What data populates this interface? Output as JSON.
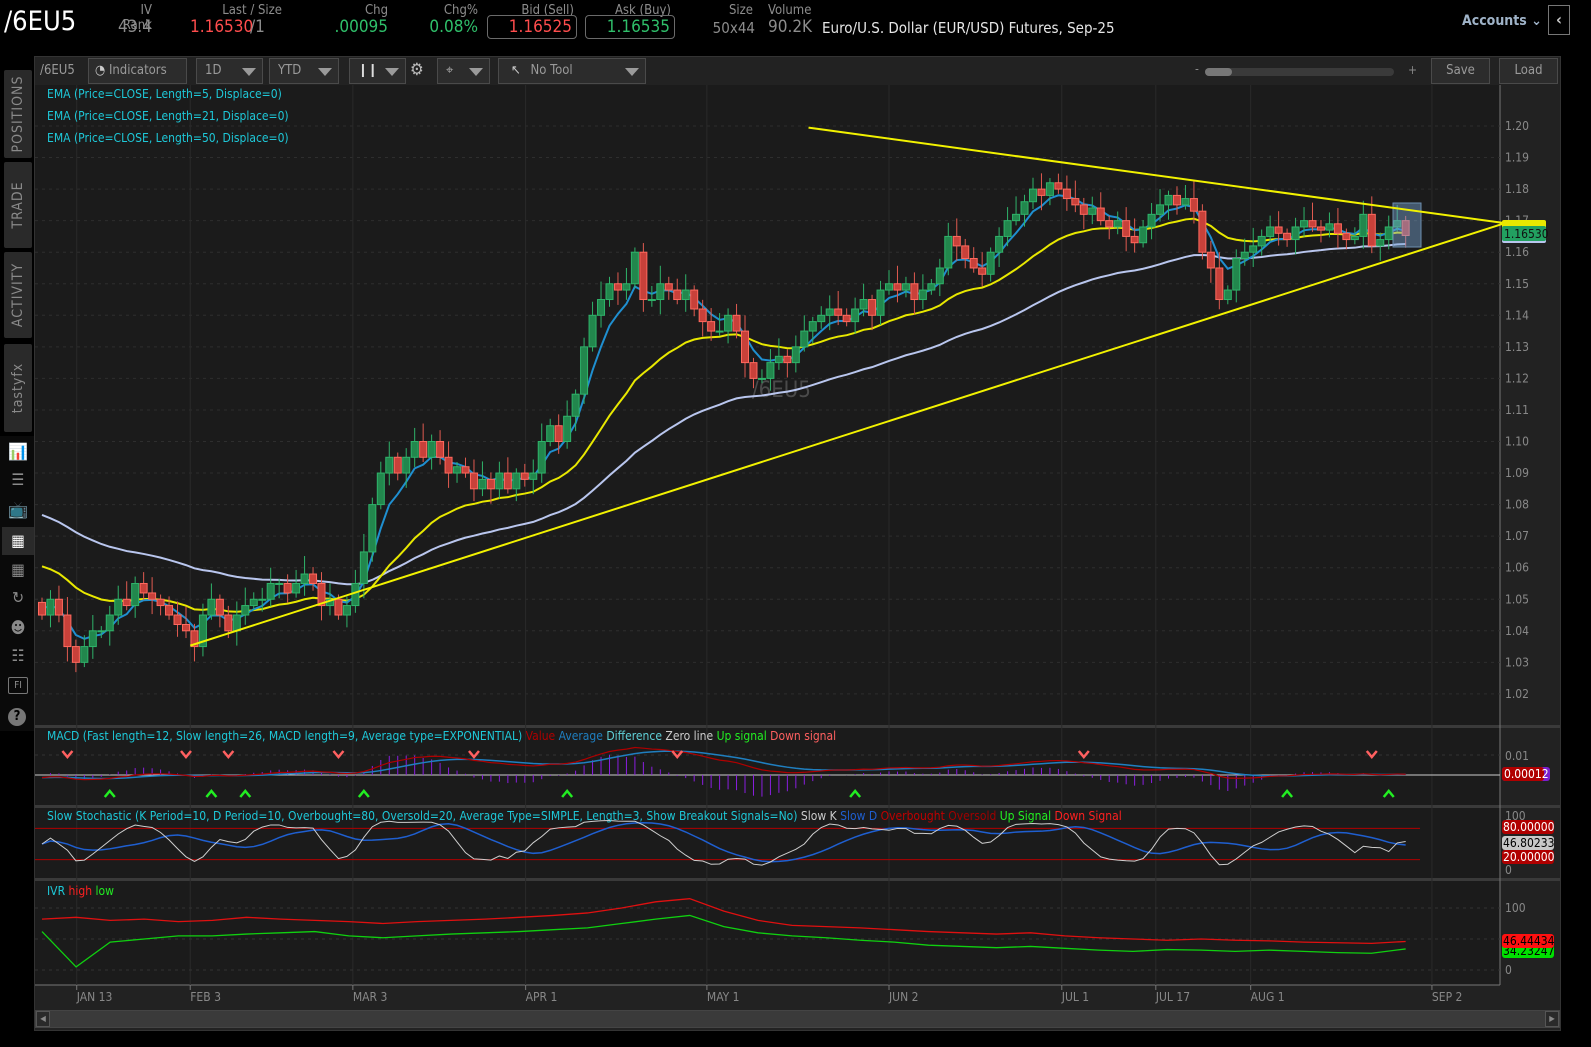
{
  "header": {
    "symbol": "/6EU5",
    "iv_rank_label": "IV Rank",
    "iv_rank": "43.4",
    "last_label": "Last / Size",
    "last": "1.16530",
    "size": "/1",
    "chg_label": "Chg",
    "chg": ".00095",
    "chgpct_label": "Chg%",
    "chgpct": "0.08%",
    "bid_label": "Bid (Sell)",
    "bid": "1.16525",
    "ask_label": "Ask (Buy)",
    "ask": "1.16535",
    "bidask_size_label": "Size",
    "bidask_size": "50x44",
    "volume_label": "Volume",
    "volume": "90.2K",
    "description": "Euro/U.S. Dollar (EUR/USD) Futures, Sep-25",
    "accounts": "Accounts"
  },
  "sidebar": {
    "tabs": [
      "POSITIONS",
      "TRADE",
      "ACTIVITY",
      "tastyfx"
    ],
    "icons": [
      "watchlist-chart-icon",
      "list-icon",
      "tv-icon",
      "chart-icon",
      "grid-icon",
      "history-icon",
      "community-icon",
      "calendar-icon",
      "fi-icon",
      "help-icon"
    ],
    "fi_label": "FI",
    "help_label": "?"
  },
  "toolbar": {
    "symbol": "/6EU5",
    "indicators": "Indicators",
    "interval": "1D",
    "range": "YTD",
    "tool": "No Tool",
    "zoom_minus": "-",
    "zoom_plus": "+",
    "zoom_level": 0.1,
    "save": "Save",
    "load": "Load"
  },
  "studies": {
    "ema5": "EMA (Price=CLOSE, Length=5, Displace=0)",
    "ema21": "EMA (Price=CLOSE, Length=21, Displace=0)",
    "ema50": "EMA (Price=CLOSE, Length=50, Displace=0)",
    "watermark": "/6EU5",
    "macd": {
      "title": "MACD (Fast length=12, Slow length=26, MACD length=9, Average type=EXPONENTIAL)",
      "value": "Value",
      "average": "Average",
      "difference": "Difference",
      "zero": "Zero line",
      "up": "Up signal",
      "down": "Down signal",
      "tick": "0.01",
      "last": "0.00012"
    },
    "stoch": {
      "title": "Slow Stochastic (K Period=10, D Period=10, Overbought=80, Oversold=20, Average Type=SIMPLE, Length=3, Show Breakout Signals=No)",
      "k": "Slow K",
      "d": "Slow D",
      "ob": "Overbought",
      "os": "Oversold",
      "up": "Up Signal",
      "down": "Down Signal",
      "t100": "100",
      "t0": "0",
      "ob_val": "80.00000",
      "k_val": "46.80233",
      "os_val": "20.00000"
    },
    "ivr": {
      "title": "IVR",
      "high": "high",
      "low": "low",
      "t100": "100",
      "t0": "0",
      "high_val": "46.44434",
      "low_val": "34.23247"
    }
  },
  "colors": {
    "up": "#22874d",
    "down": "#c8413a",
    "ema5": "#1f8fd0",
    "ema21": "#e8e800",
    "ema50": "#b9c6ee",
    "trend": "#f2f200",
    "bid": "#ff4d4d",
    "ask": "#2fbf6a"
  },
  "chart_data": {
    "type": "candlestick",
    "title": "/6EU5 1D YTD",
    "ylim": [
      1.015,
      1.205
    ],
    "yticks": [
      "1.20",
      "1.19",
      "1.18",
      "1.17",
      "1.16",
      "1.15",
      "1.14",
      "1.13",
      "1.12",
      "1.11",
      "1.10",
      "1.09",
      "1.08",
      "1.07",
      "1.06",
      "1.05",
      "1.04",
      "1.03",
      "1.02"
    ],
    "xticks": [
      {
        "label": "JAN 13",
        "i": 4.1
      },
      {
        "label": "FEB 3",
        "i": 17.5
      },
      {
        "label": "MAR 3",
        "i": 36.7
      },
      {
        "label": "APR 1",
        "i": 57.1
      },
      {
        "label": "MAY 1",
        "i": 78.5
      },
      {
        "label": "JUN 2",
        "i": 100
      },
      {
        "label": "JUL 1",
        "i": 120.4
      },
      {
        "label": "JUL 17",
        "i": 131.5
      },
      {
        "label": "AUG 1",
        "i": 142.7
      },
      {
        "label": "SEP 2",
        "i": 164.1
      }
    ],
    "last_price_label": "1.16530",
    "closes": [
      1.045,
      1.05,
      1.045,
      1.035,
      1.03,
      1.035,
      1.04,
      1.04,
      1.045,
      1.05,
      1.048,
      1.055,
      1.052,
      1.05,
      1.048,
      1.045,
      1.042,
      1.04,
      1.035,
      1.045,
      1.05,
      1.045,
      1.04,
      1.045,
      1.048,
      1.05,
      1.05,
      1.055,
      1.055,
      1.052,
      1.055,
      1.058,
      1.055,
      1.048,
      1.05,
      1.045,
      1.048,
      1.055,
      1.065,
      1.08,
      1.09,
      1.095,
      1.09,
      1.095,
      1.1,
      1.095,
      1.1,
      1.095,
      1.09,
      1.092,
      1.09,
      1.085,
      1.088,
      1.085,
      1.09,
      1.085,
      1.09,
      1.088,
      1.09,
      1.1,
      1.105,
      1.1,
      1.108,
      1.115,
      1.13,
      1.14,
      1.145,
      1.15,
      1.148,
      1.15,
      1.16,
      1.145,
      1.145,
      1.15,
      1.148,
      1.145,
      1.148,
      1.142,
      1.138,
      1.135,
      1.135,
      1.14,
      1.135,
      1.125,
      1.12,
      1.12,
      1.125,
      1.127,
      1.125,
      1.13,
      1.135,
      1.138,
      1.14,
      1.142,
      1.14,
      1.138,
      1.142,
      1.145,
      1.14,
      1.148,
      1.15,
      1.148,
      1.15,
      1.145,
      1.148,
      1.15,
      1.155,
      1.165,
      1.162,
      1.158,
      1.155,
      1.153,
      1.16,
      1.165,
      1.17,
      1.172,
      1.176,
      1.18,
      1.178,
      1.182,
      1.18,
      1.177,
      1.175,
      1.172,
      1.174,
      1.17,
      1.168,
      1.17,
      1.165,
      1.163,
      1.168,
      1.172,
      1.175,
      1.178,
      1.175,
      1.177,
      1.173,
      1.16,
      1.155,
      1.145,
      1.148,
      1.158,
      1.16,
      1.162,
      1.165,
      1.168,
      1.166,
      1.164,
      1.168,
      1.17,
      1.168,
      1.167,
      1.169,
      1.166,
      1.164,
      1.165,
      1.172,
      1.162,
      1.164,
      1.168,
      1.17,
      1.1653
    ],
    "trendlines": [
      {
        "name": "upper",
        "from": {
          "i": 90.5,
          "price": 1.1995
        },
        "to": {
          "i": 172.7,
          "price": 1.1692
        }
      },
      {
        "name": "lower",
        "from": {
          "i": 17.5,
          "price": 1.0353
        },
        "to": {
          "i": 172.7,
          "price": 1.1692
        }
      }
    ],
    "ivr_high": [
      82,
      85,
      80,
      82,
      78,
      80,
      85,
      82,
      80,
      78,
      75,
      78,
      80,
      82,
      85,
      88,
      92,
      100,
      110,
      115,
      95,
      80,
      72,
      70,
      68,
      65,
      62,
      60,
      58,
      60,
      55,
      52,
      50,
      48,
      50,
      48,
      47,
      45,
      44,
      43,
      46
    ],
    "ivr_low": [
      62,
      5,
      45,
      50,
      55,
      55,
      58,
      60,
      62,
      55,
      52,
      55,
      58,
      60,
      62,
      65,
      68,
      75,
      82,
      88,
      70,
      60,
      55,
      52,
      48,
      45,
      40,
      38,
      36,
      38,
      35,
      32,
      30,
      33,
      32,
      30,
      32,
      30,
      28,
      27,
      34
    ]
  }
}
